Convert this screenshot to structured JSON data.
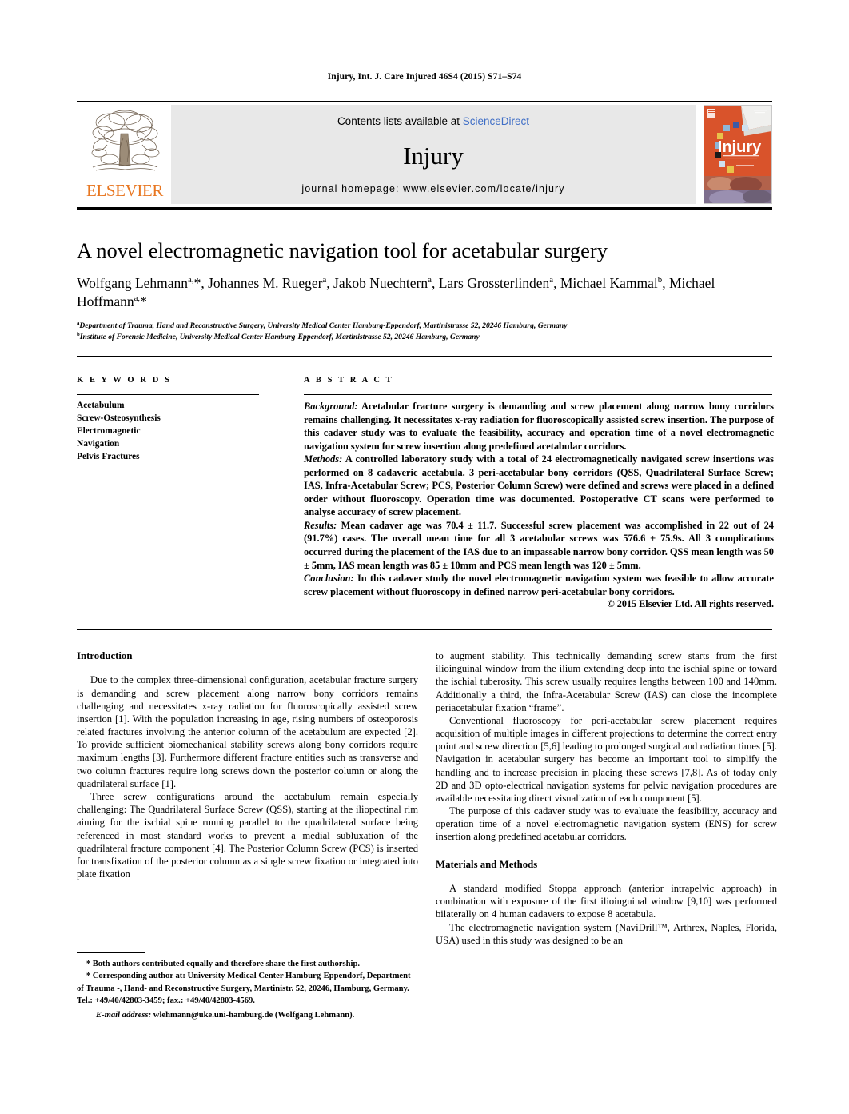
{
  "running_head": "Injury, Int. J. Care Injured 46S4 (2015) S71–S74",
  "masthead": {
    "publisher_name": "ELSEVIER",
    "contents_prefix": "Contents lists available at ",
    "contents_link": "ScienceDirect",
    "journal_title": "Injury",
    "homepage_line": "journal homepage: www.elsevier.com/locate/injury",
    "cover_title": "Injury",
    "cover_subtitle": "International Journal of the Care of the Injured",
    "link_color": "#3f6ec6",
    "panel_bg": "#e8e8e8",
    "brand_color": "#E87722",
    "cover_accent": "#D9532B"
  },
  "article": {
    "title": "A novel electromagnetic navigation tool for acetabular surgery",
    "authors_line1": "Wolfgang Lehmann",
    "authors_html": "Wolfgang Lehmann<sup>a,</sup>*, Johannes M. Rueger<sup>a</sup>, Jakob Nuechtern<sup>a</sup>, Lars Grossterlinden<sup>a</sup>, Michael Kammal<sup>b</sup>, Michael Hoffmann<sup>a,</sup>*",
    "affiliation_a": "Department of Trauma, Hand and Reconstructive Surgery, University Medical Center Hamburg-Eppendorf, Martinistrasse 52, 20246 Hamburg, Germany",
    "affiliation_b": "Institute of Forensic Medicine, University Medical Center Hamburg-Eppendorf, Martinistrasse 52, 20246 Hamburg, Germany",
    "affiliation_a_marker": "a",
    "affiliation_b_marker": "b"
  },
  "keywords": {
    "heading": "K E Y W O R D S",
    "items": [
      "Acetabulum",
      "Screw-Osteosynthesis",
      "Electromagnetic",
      "Navigation",
      "Pelvis Fractures"
    ]
  },
  "abstract": {
    "heading": "A B S T R A C T",
    "background_label": "Background:",
    "background_text": " Acetabular fracture surgery is demanding and screw placement along narrow bony corridors remains challenging. It necessitates x-ray radiation for fluoroscopically assisted screw insertion. The purpose of this cadaver study was to evaluate the feasibility, accuracy and operation time of a novel electromagnetic navigation system for screw insertion along predefined acetabular corridors.",
    "methods_label": "Methods:",
    "methods_text": " A controlled laboratory study with a total of 24 electromagnetically navigated screw insertions was performed on 8 cadaveric acetabula. 3 peri-acetabular bony corridors (QSS, Quadrilateral Surface Screw; IAS, Infra-Acetabular Screw; PCS, Posterior Column Screw) were defined and screws were placed in a defined order without fluoroscopy. Operation time was documented. Postoperative CT scans were performed to analyse accuracy of screw placement.",
    "results_label": "Results:",
    "results_text": " Mean cadaver age was 70.4 ± 11.7. Successful screw placement was accomplished in 22 out of 24 (91.7%) cases. The overall mean time for all 3 acetabular screws was 576.6 ± 75.9s. All 3 complications occurred during the placement of the IAS due to an impassable narrow bony corridor. QSS mean length was 50 ± 5mm, IAS mean length was 85 ± 10mm and PCS mean length was 120 ± 5mm.",
    "conclusion_label": "Conclusion:",
    "conclusion_text": " In this cadaver study the novel electromagnetic navigation system was feasible to allow accurate screw placement without fluoroscopy in defined narrow peri-acetabular bony corridors.",
    "copyright": "© 2015 Elsevier Ltd. All rights reserved."
  },
  "body": {
    "left_column": {
      "heading": "Introduction",
      "paragraphs": [
        "Due to the complex three-dimensional configuration, acetabular fracture surgery is demanding and screw placement along narrow bony corridors remains challenging and necessitates x-ray radiation for fluoroscopically assisted screw insertion [1]. With the population increasing in age, rising numbers of osteoporosis related fractures involving the anterior column of the acetabulum are expected [2]. To provide sufficient biomechanical stability screws along bony corridors require maximum lengths [3]. Furthermore different fracture entities such as transverse and two column fractures require long screws down the posterior column or along the quadrilateral surface [1].",
        "Three screw configurations around the acetabulum remain especially challenging: The Quadrilateral Surface Screw (QSS), starting at the iliopectinal rim aiming for the ischial spine running parallel to the quadrilateral surface being referenced in most standard works to prevent a medial subluxation of the quadrilateral fracture component [4]. The Posterior Column Screw (PCS) is inserted for transfixation of the posterior column as a single screw fixation or integrated into plate fixation"
      ]
    },
    "right_column": {
      "paragraphs": [
        "to augment stability. This technically demanding screw starts from the first ilioinguinal window from the ilium extending deep into the ischial spine or toward the ischial tuberosity. This screw usually requires lengths between 100 and 140mm. Additionally a third, the Infra-Acetabular Screw (IAS) can close the incomplete periacetabular fixation “frame”.",
        "Conventional fluoroscopy for peri-acetabular screw placement requires acquisition of multiple images in different projections to determine the correct entry point and screw direction [5,6] leading to prolonged surgical and radiation times [5]. Navigation in acetabular surgery has become an important tool to simplify the handling and to increase precision in placing these screws [7,8]. As of today only 2D and 3D opto-electrical navigation systems for pelvic navigation procedures are available necessitating direct visualization of each component [5].",
        "The purpose of this cadaver study was to evaluate the feasibility, accuracy and operation time of a novel electromagnetic navigation system (ENS) for screw insertion along predefined acetabular corridors."
      ],
      "heading": "Materials and Methods",
      "paragraphs2": [
        "A standard modified Stoppa approach (anterior intrapelvic approach) in combination with exposure of the first ilioinguinal window [9,10] was performed bilaterally on 4 human cadavers to expose 8 acetabula.",
        "The electromagnetic navigation system (NaviDrill™, Arthrex, Naples, Florida, USA) used in this study was designed to be an"
      ]
    }
  },
  "footnotes": {
    "equal_contribution": "Both authors contributed equally and therefore share the first authorship.",
    "corresponding": "Corresponding author at: University Medical Center Hamburg-Eppendorf, Department of Trauma -, Hand- and Reconstructive Surgery, Martinistr. 52, 20246, Hamburg, Germany. Tel.: +49/40/42803-3459; fax.: +49/40/42803-4569.",
    "email_label": "E-mail address:",
    "email_value": " wlehmann@uke.uni-hamburg.de (Wolfgang Lehmann).",
    "star_glyph": "*"
  }
}
